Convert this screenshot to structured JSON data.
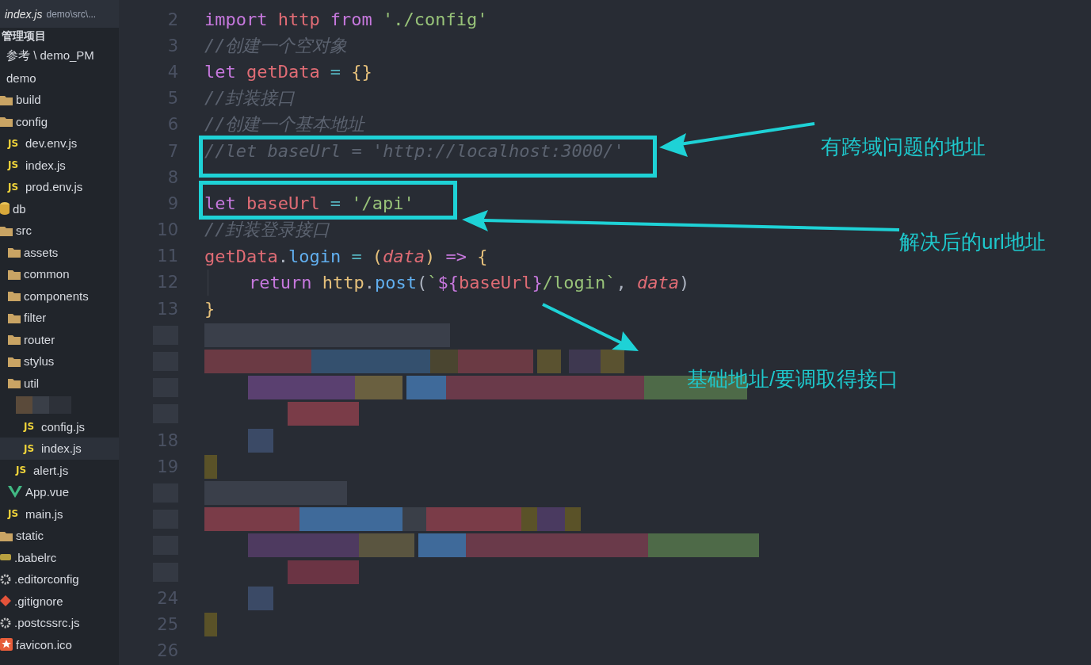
{
  "tab": {
    "file": "index.js",
    "path": "demo\\src\\...",
    "selected": true
  },
  "sidebar": {
    "title": "管理项目",
    "tree": [
      {
        "label": "参考 \\ demo_PM",
        "selected": false
      },
      {
        "label": "demo",
        "selected": false,
        "children": [
          {
            "label": "build",
            "kind": "folder",
            "selected": false
          },
          {
            "label": "config",
            "kind": "folder",
            "selected": false,
            "children": [
              {
                "label": "dev.env.js",
                "kind": "script",
                "badge": "JS",
                "selected": false
              },
              {
                "label": "index.js",
                "kind": "script",
                "badge": "JS",
                "selected": false
              },
              {
                "label": "prod.env.js",
                "kind": "script",
                "badge": "JS",
                "selected": false
              }
            ]
          },
          {
            "label": "db",
            "kind": "database",
            "selected": false
          },
          {
            "label": "src",
            "kind": "folder",
            "selected": false,
            "children": [
              {
                "label": "assets",
                "kind": "folder",
                "selected": false
              },
              {
                "label": "common",
                "kind": "folder",
                "selected": false
              },
              {
                "label": "components",
                "kind": "folder",
                "selected": false
              },
              {
                "label": "filter",
                "kind": "folder",
                "selected": false
              },
              {
                "label": "router",
                "kind": "folder",
                "selected": false
              },
              {
                "label": "stylus",
                "kind": "folder",
                "selected": false
              },
              {
                "label": "util",
                "kind": "folder",
                "selected": false,
                "children": [
                  {
                    "kind": "blurred",
                    "children": [
                      {
                        "label": "config.js",
                        "kind": "script",
                        "badge": "JS",
                        "selected": false
                      },
                      {
                        "label": "index.js",
                        "kind": "script",
                        "badge": "JS",
                        "selected": true
                      }
                    ]
                  },
                  {
                    "label": "alert.js",
                    "kind": "script",
                    "badge": "JS",
                    "selected": false
                  }
                ]
              },
              {
                "label": "App.vue",
                "kind": "vue",
                "selected": false
              },
              {
                "label": "main.js",
                "kind": "script",
                "badge": "JS",
                "selected": false
              }
            ]
          },
          {
            "label": "static",
            "kind": "folder",
            "selected": false
          },
          {
            "label": ".babelrc",
            "kind": "babel",
            "selected": false
          },
          {
            "label": ".editorconfig",
            "kind": "gear",
            "selected": false
          },
          {
            "label": ".gitignore",
            "kind": "git",
            "selected": false
          },
          {
            "label": ".postcssrc.js",
            "kind": "gear",
            "selected": false
          },
          {
            "label": "favicon.ico",
            "kind": "star",
            "selected": false
          }
        ]
      }
    ]
  },
  "code": [
    {
      "number": "2",
      "tokens": [
        {
          "t": "import",
          "kind": "keyword"
        },
        {
          "t": "http",
          "kind": "var",
          "space": true
        },
        {
          "t": "from",
          "kind": "keyword",
          "space": true
        },
        {
          "t": "'./config'",
          "kind": "string",
          "space": true
        }
      ]
    },
    {
      "number": "3",
      "tokens": [
        {
          "t": "//创建一个空对象",
          "kind": "comment"
        }
      ]
    },
    {
      "number": "4",
      "tokens": [
        {
          "t": "let",
          "kind": "keyword"
        },
        {
          "t": "getData",
          "kind": "var",
          "space": true
        },
        {
          "t": "=",
          "kind": "op",
          "space": true
        },
        {
          "t": "{}",
          "kind": "brace",
          "space": true
        }
      ]
    },
    {
      "number": "5",
      "tokens": [
        {
          "t": "//封装接口",
          "kind": "comment"
        }
      ]
    },
    {
      "number": "6",
      "tokens": [
        {
          "t": "//创建一个基本地址",
          "kind": "comment"
        }
      ]
    },
    {
      "number": "7",
      "tokens": [
        {
          "t": "//let baseUrl = 'http://localhost:3000/'",
          "kind": "comment"
        }
      ]
    },
    {
      "number": "8"
    },
    {
      "number": "9",
      "tokens": [
        {
          "t": "let",
          "kind": "keyword"
        },
        {
          "t": "baseUrl",
          "kind": "var",
          "space": true
        },
        {
          "t": "=",
          "kind": "op",
          "space": true
        },
        {
          "t": "'/api'",
          "kind": "string",
          "space": true
        }
      ]
    },
    {
      "number": "10",
      "tokens": [
        {
          "t": "//封装登录接口",
          "kind": "comment"
        }
      ]
    },
    {
      "number": "11",
      "tokens": [
        {
          "t": "getData",
          "kind": "var"
        },
        {
          "t": ".",
          "kind": "plain"
        },
        {
          "t": "login",
          "kind": "prop"
        },
        {
          "t": "=",
          "kind": "op",
          "space": true
        },
        {
          "t": "(",
          "kind": "brace",
          "space": true
        },
        {
          "t": "data",
          "kind": "param"
        },
        {
          "t": ")",
          "kind": "brace"
        },
        {
          "t": "=>",
          "kind": "keyword",
          "space": true
        },
        {
          "t": "{",
          "kind": "brace",
          "space": true
        }
      ]
    },
    {
      "number": "12",
      "indented": true,
      "tokens": [
        {
          "t": "return",
          "kind": "keyword"
        },
        {
          "t": "http",
          "kind": "type",
          "space": true
        },
        {
          "t": ".",
          "kind": "plain"
        },
        {
          "t": "post",
          "kind": "prop"
        },
        {
          "t": "(",
          "kind": "plain"
        },
        {
          "t": "`",
          "kind": "string"
        },
        {
          "t": "${",
          "kind": "keyword"
        },
        {
          "t": "baseUrl",
          "kind": "var"
        },
        {
          "t": "}",
          "kind": "keyword"
        },
        {
          "t": "/login`",
          "kind": "string"
        },
        {
          "t": ",",
          "kind": "plain"
        },
        {
          "t": "data",
          "kind": "param",
          "space": true
        },
        {
          "t": ")",
          "kind": "plain"
        }
      ]
    },
    {
      "number": "13",
      "tokens": [
        {
          "t": "}",
          "kind": "brace"
        }
      ]
    },
    {
      "kind": "blurred"
    },
    {
      "kind": "blurred"
    },
    {
      "kind": "blurred"
    },
    {
      "kind": "blurred"
    },
    {
      "kind": "blurred",
      "number": "18"
    },
    {
      "kind": "blurred",
      "number": "19"
    },
    {
      "kind": "blurred"
    },
    {
      "kind": "blurred"
    },
    {
      "kind": "blurred"
    },
    {
      "kind": "blurred"
    },
    {
      "kind": "blurred",
      "number": "24"
    },
    {
      "kind": "blurred",
      "number": "25"
    },
    {
      "number": "26"
    }
  ],
  "annotations": [
    {
      "text": "有跨域问题的地址"
    },
    {
      "text": "解决后的url地址"
    },
    {
      "text": "基础地址/要调取得接口"
    }
  ]
}
